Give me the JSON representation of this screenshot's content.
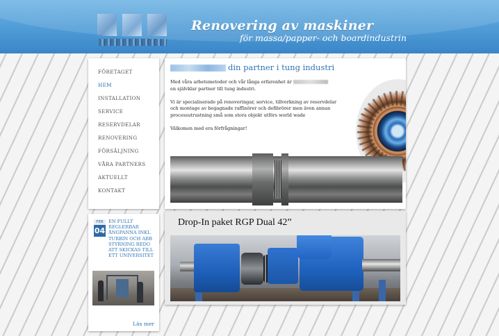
{
  "header": {
    "tagline_main": "Renovering av maskiner",
    "tagline_sub": "för massa/papper- och boardindustrin"
  },
  "nav": {
    "items": [
      {
        "label": "FÖRETAGET",
        "active": false
      },
      {
        "label": "HEM",
        "active": true
      },
      {
        "label": "INSTALLATION",
        "active": false
      },
      {
        "label": "SERVICE",
        "active": false
      },
      {
        "label": "RESERVDELAR",
        "active": false
      },
      {
        "label": "RENOVERING",
        "active": false
      },
      {
        "label": "FÖRSÄLJNING",
        "active": false
      },
      {
        "label": "VÅRA PARTNERS",
        "active": false
      },
      {
        "label": "AKTUELLT",
        "active": false
      },
      {
        "label": "KONTAKT",
        "active": false
      }
    ]
  },
  "news": {
    "month": "FEB",
    "day": "04",
    "title": "EN FULLT REGLERBAR ÅNGPANNA INKL TURBIN OCH ABB STYRNING REDO ATT SKICKAS TILL ETT UNIVERSITET",
    "read_more": "Läs mer"
  },
  "main": {
    "title_suffix": "din partner i tung industri",
    "p1_before": "Med våra arbetsmetoder och vår långa erfarenhet är",
    "p1_after": "en självklar partner till tung industri.",
    "p2": "Vi är specialiserade på renoveringar, service, tillverkning av reservdelar och montage av begagnade raffinörer och defibrörer men även annan processutrustning små som stora objekt utförs world wade",
    "p3": "Välkomen med era förfrågningar!"
  },
  "promo": {
    "title": "Drop-In paket RGP Dual 42”"
  }
}
